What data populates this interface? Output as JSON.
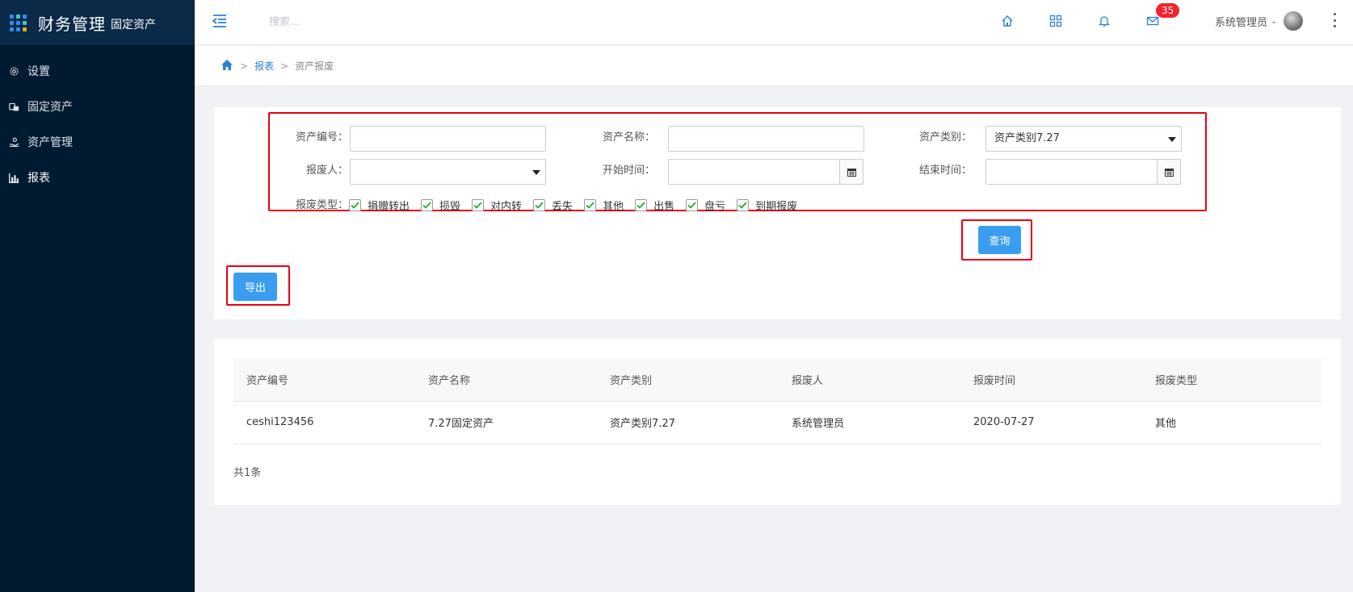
{
  "brand": {
    "title": "财务管理",
    "subtitle": "固定资产"
  },
  "sidebar": {
    "items": [
      {
        "label": "设置",
        "icon": "gear-icon"
      },
      {
        "label": "固定资产",
        "icon": "assets-icon"
      },
      {
        "label": "资产管理",
        "icon": "hand-coin-icon"
      },
      {
        "label": "报表",
        "icon": "bar-chart-icon",
        "active": true
      }
    ]
  },
  "header": {
    "search_placeholder": "搜索...",
    "mail_badge": "35",
    "user_name": "系统管理员"
  },
  "breadcrumb": {
    "section": "报表",
    "page": "资产报废"
  },
  "filters": {
    "asset_no_label": "资产编号：",
    "asset_no_value": "",
    "asset_name_label": "资产名称：",
    "asset_name_value": "",
    "asset_type_label": "资产类别：",
    "asset_type_value": "资产类别7.27",
    "scrapper_label": "报废人：",
    "scrapper_value": "",
    "start_label": "开始时间：",
    "start_value": "",
    "end_label": "结束时间：",
    "end_value": "",
    "type_label": "报废类型：",
    "types": [
      {
        "label": "捐赠转出",
        "checked": true
      },
      {
        "label": "损毁",
        "checked": true
      },
      {
        "label": "对内转",
        "checked": true
      },
      {
        "label": "丢失",
        "checked": true
      },
      {
        "label": "其他",
        "checked": true
      },
      {
        "label": "出售",
        "checked": true
      },
      {
        "label": "盘亏",
        "checked": true
      },
      {
        "label": "到期报废",
        "checked": true
      }
    ],
    "query_label": "查询",
    "export_label": "导出"
  },
  "table": {
    "columns": [
      "资产编号",
      "资产名称",
      "资产类别",
      "报废人",
      "报废时间",
      "报废类型"
    ],
    "rows": [
      [
        "ceshi123456",
        "7.27固定资产",
        "资产类别7.27",
        "系统管理员",
        "2020-07-27",
        "其他"
      ]
    ],
    "total": "共1条"
  },
  "colors": {
    "sidebar_bg": "#001a2f",
    "brand_bg": "#0b2a47",
    "primary": "#3a9df2",
    "highlight": "#e60012"
  }
}
